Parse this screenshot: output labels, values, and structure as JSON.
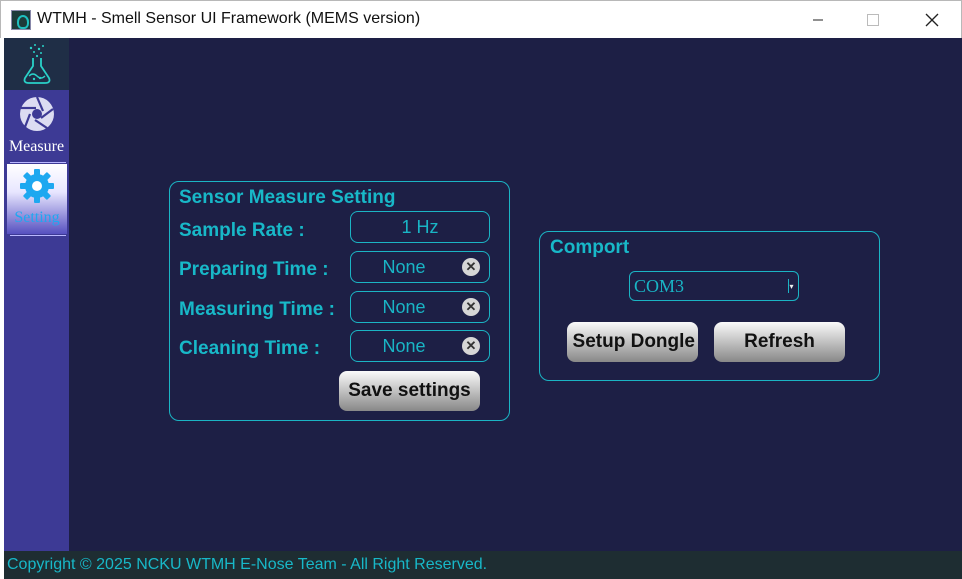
{
  "window": {
    "title": "WTMH - Smell Sensor UI Framework (MEMS version)",
    "controls": {
      "minimize_icon": "minimize-icon",
      "maximize_icon": "maximize-icon",
      "close_icon": "close-icon"
    }
  },
  "sidebar": {
    "logo_icon": "flask-logo-icon",
    "items": [
      {
        "label": "Measure",
        "icon": "aperture-icon",
        "active": false
      },
      {
        "label": "Setting",
        "icon": "gear-icon",
        "active": true
      }
    ]
  },
  "sensor_settings": {
    "title": "Sensor Measure Setting",
    "sample_rate": {
      "label": "Sample Rate :",
      "value": "1 Hz"
    },
    "preparing_time": {
      "label": "Preparing Time :",
      "value": "None"
    },
    "measuring_time": {
      "label": "Measuring Time :",
      "value": "None"
    },
    "cleaning_time": {
      "label": "Cleaning Time :",
      "value": "None"
    },
    "save_label": "Save settings"
  },
  "comport": {
    "title": "Comport",
    "selected": "COM3",
    "setup_label": "Setup Dongle",
    "refresh_label": "Refresh"
  },
  "footer": {
    "text": "Copyright © 2025 NCKU WTMH E-Nose Team - All Right Reserved."
  },
  "colors": {
    "accent": "#18b8c8",
    "background": "#1d1f45",
    "sidebar": "#3d3a95",
    "footer": "#1e2d32"
  }
}
